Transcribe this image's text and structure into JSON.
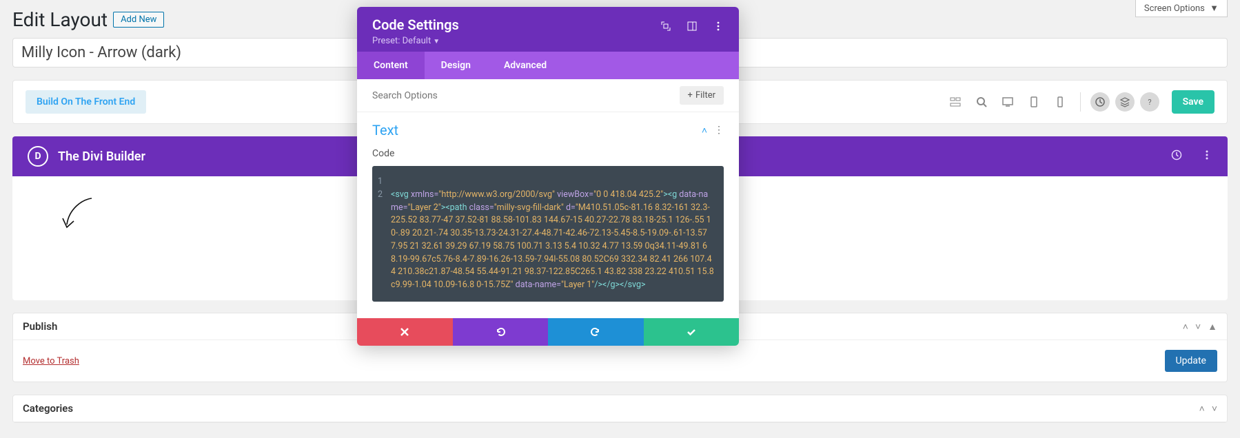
{
  "screen_options": "Screen Options",
  "heading": "Edit Layout",
  "add_new": "Add New",
  "title_value": "Milly Icon - Arrow (dark)",
  "toolbar": {
    "build_front": "Build On The Front End",
    "save": "Save"
  },
  "divi": {
    "title": "The Divi Builder"
  },
  "modal": {
    "title": "Code Settings",
    "preset_label": "Preset: Default",
    "tabs": {
      "content": "Content",
      "design": "Design",
      "advanced": "Advanced"
    },
    "search_placeholder": "Search Options",
    "filter": "Filter",
    "section_title": "Text",
    "code_label": "Code",
    "code_lines": [
      "1",
      "2"
    ],
    "code_plain1": " ",
    "code_tag_open": "<svg",
    "code_attr_xmlns": " xmlns=",
    "code_val_xmlns": "\"http://www.w3.org/2000/svg\"",
    "code_attr_viewbox": " viewBox=",
    "code_val_viewbox": "\"0 0 418.04 425.2\"",
    "code_tag_close1": ">",
    "code_tag_g": "<g",
    "code_attr_dataname1": " data-name=",
    "code_val_layer2": "\"Layer 2\"",
    "code_tag_close2": ">",
    "code_tag_path": "<path",
    "code_attr_class": " class=",
    "code_val_class": "\"milly-svg-fill-dark\"",
    "code_attr_d": " d=",
    "code_val_d": "\"M410.51.05c-81.16 8.32-161 32.3-225.52 83.77-47 37.52-81 88.58-101.83 144.67-15 40.27-22.78 83.18-25.1 126-.55 10-.89 20.21-.74 30.35-13.73-24.31-27.4-48.71-42.46-72.13-5.45-8.5-19.09-.61-13.57 7.95 21 32.61 39.29 67.19 58.75 100.71 3.13 5.4 10.32 4.77 13.59 0q34.11-49.81 68.19-99.67c5.76-8.4-7.89-16.26-13.59-7.94l-55.08 80.52C69 332.34 82.41 266 107.44 210.38c21.87-48.54 55.44-91.21 98.37-122.85C265.1 43.82 338 23.22 410.51 15.8c9.99-1.04 10.09-16.8 0-15.75Z\"",
    "code_attr_dataname2": " data-name=",
    "code_val_layer1": "\"Layer 1\"",
    "code_tag_selfclose": "/>",
    "code_tag_gclose": "</g>",
    "code_tag_svgclose": "</svg>"
  },
  "publish": {
    "title": "Publish",
    "trash": "Move to Trash",
    "update": "Update"
  },
  "categories": {
    "title": "Categories"
  }
}
